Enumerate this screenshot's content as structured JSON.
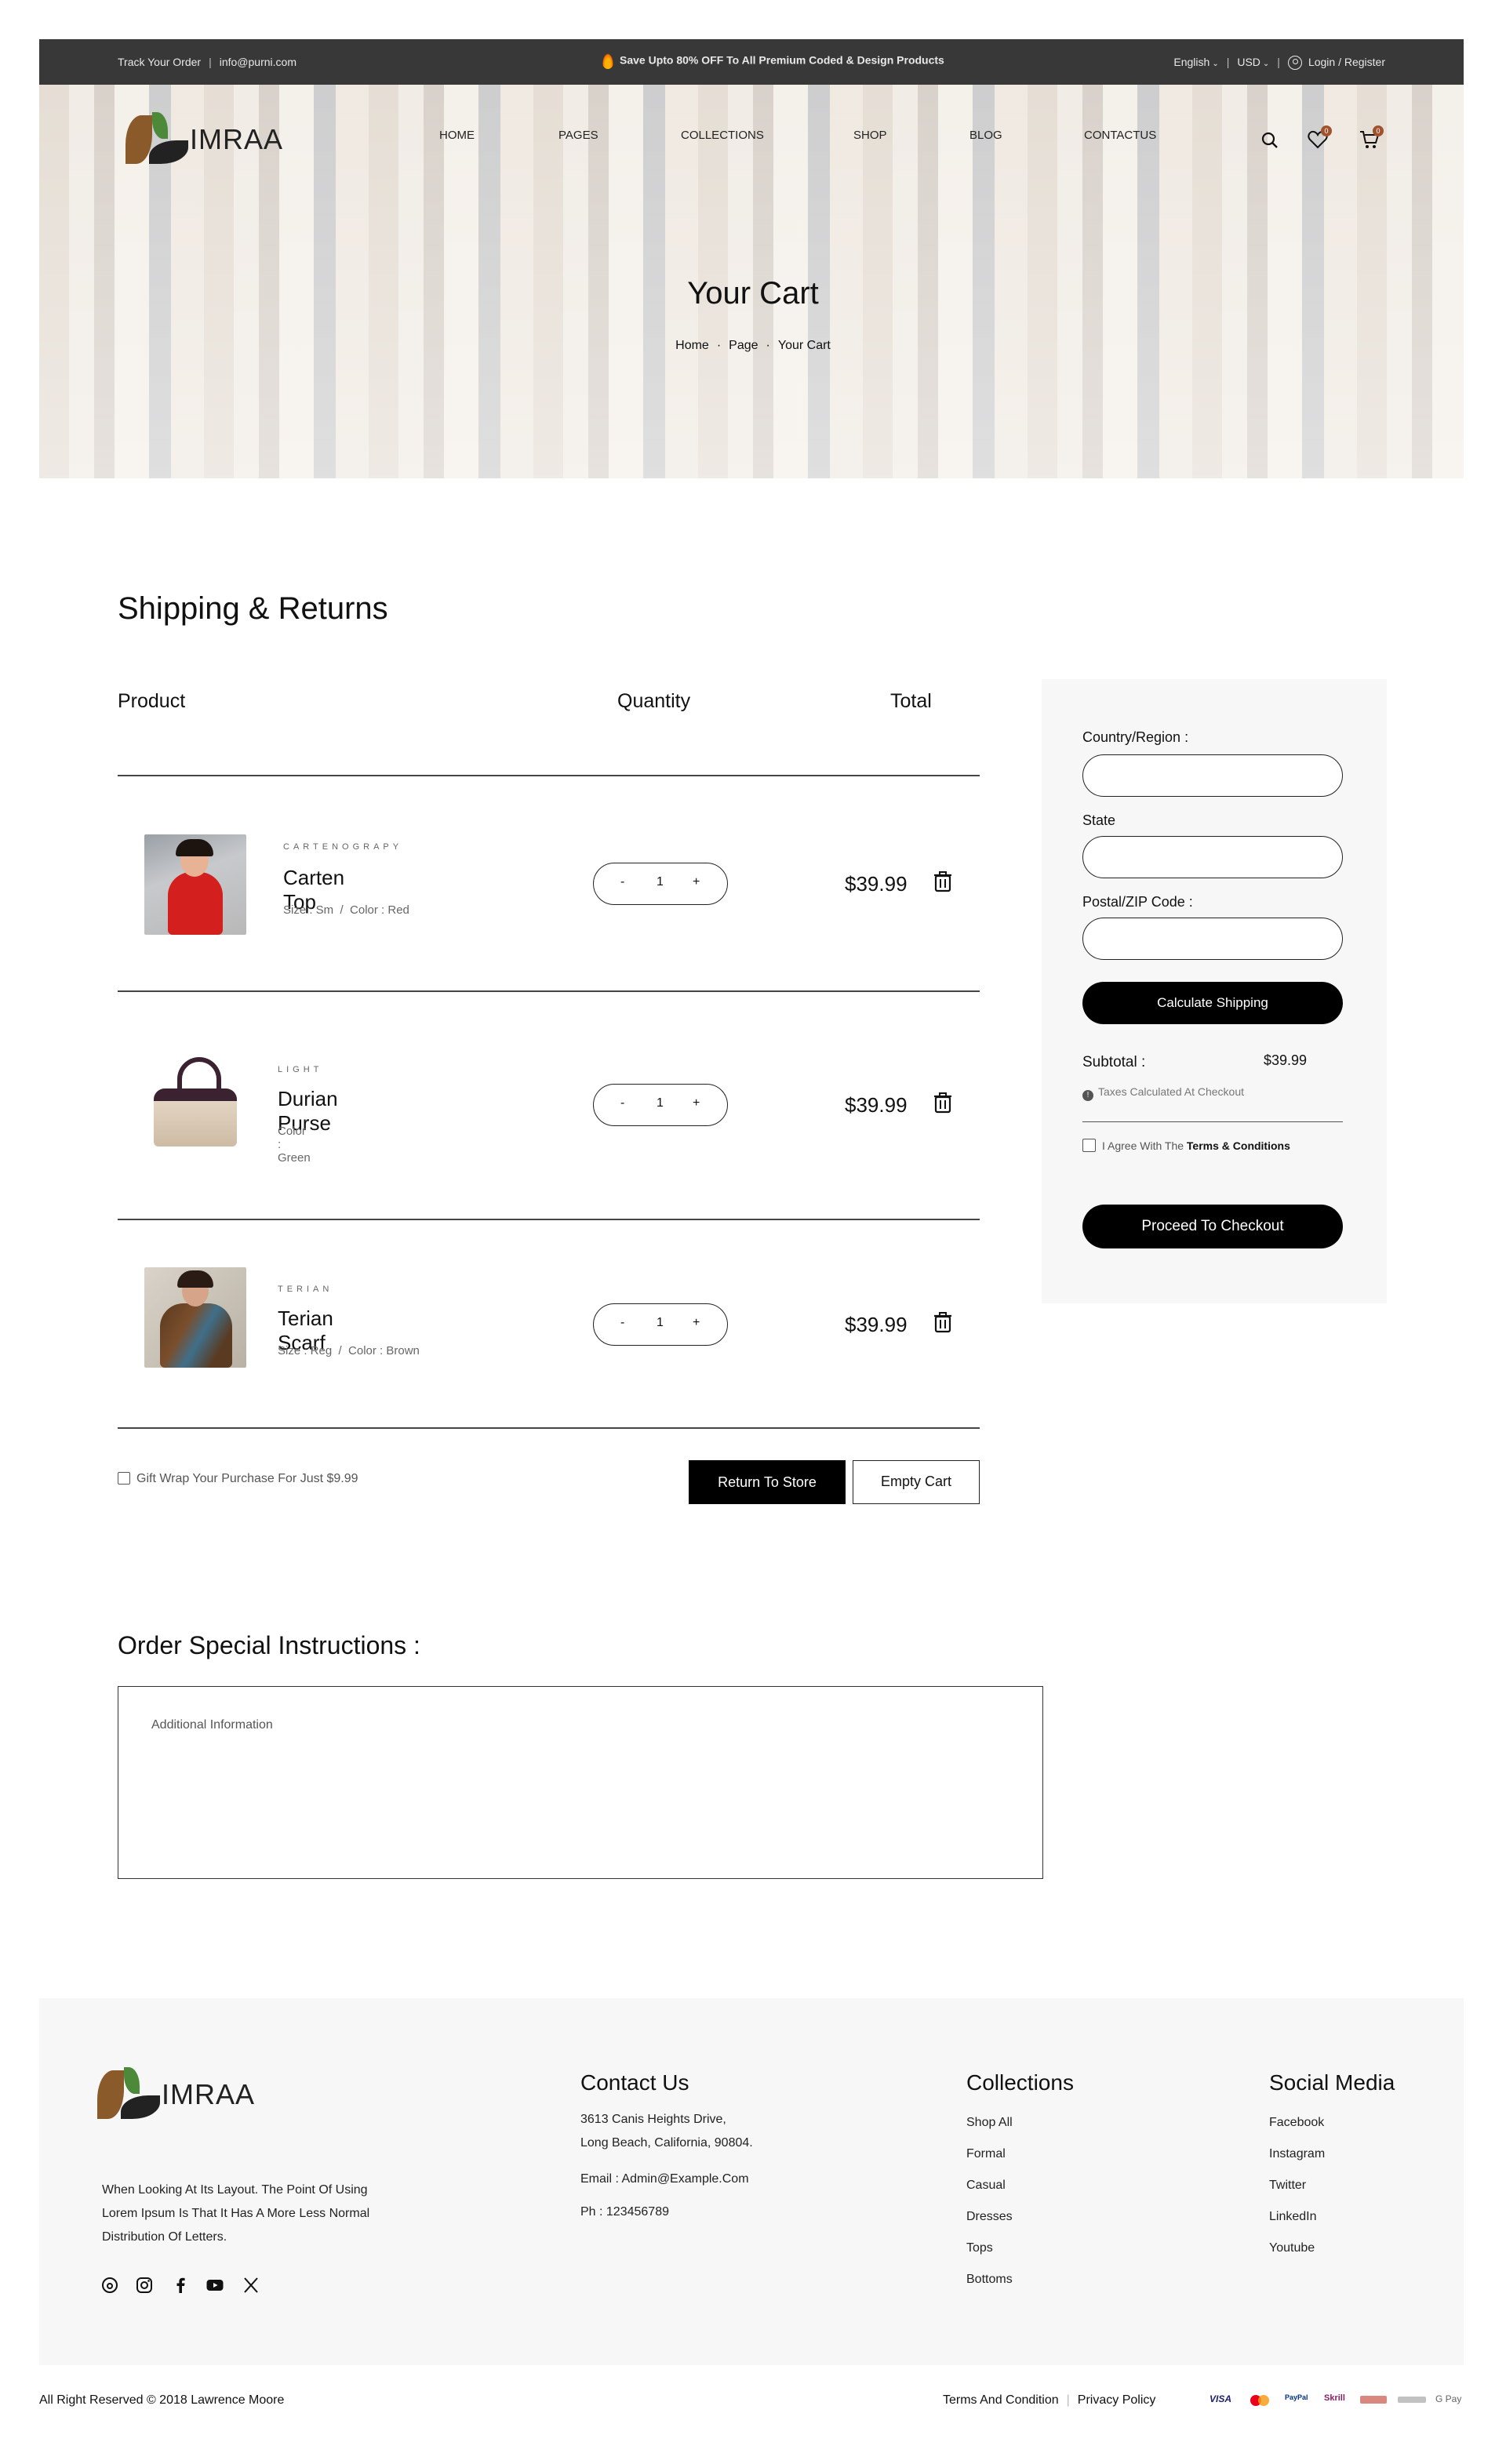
{
  "topbar": {
    "track": "Track Your Order",
    "email": "info@purni.com",
    "promo": "Save Upto 80% OFF To All Premium Coded & Design Products",
    "language": "English",
    "currency": "USD",
    "login": "Login / Register"
  },
  "brand": {
    "name": "IMRAA"
  },
  "nav": {
    "home": "HOME",
    "pages": "PAGES",
    "collections": "COLLECTIONS",
    "shop": "SHOP",
    "blog": "BLOG",
    "contact": "CONTACTUS"
  },
  "header_icons": {
    "search": "search-icon",
    "wishlist": "heart-icon",
    "cart": "cart-icon",
    "wishlist_count": "0",
    "cart_count": "0"
  },
  "hero": {
    "title": "Your Cart",
    "crumb_home": "Home",
    "crumb_page": "Page",
    "crumb_current": "Your Cart"
  },
  "cart": {
    "section_title": "Shipping & Returns",
    "col_product": "Product",
    "col_quantity": "Quantity",
    "col_total": "Total",
    "items": [
      {
        "category": "CARTENOGRAPY",
        "name": "Carten Top",
        "meta": "Size : Sm  /  Color : Red",
        "qty": "1",
        "price": "$39.99"
      },
      {
        "category": "LIGHT",
        "name": "Durian Purse",
        "meta": "Color : Green",
        "qty": "1",
        "price": "$39.99"
      },
      {
        "category": "TERIAN",
        "name": "Terian Scarf",
        "meta": "Size : Reg  /  Color : Brown",
        "qty": "1",
        "price": "$39.99"
      }
    ],
    "gift_wrap": "Gift Wrap Your Purchase For Just $9.99",
    "return_btn": "Return To Store",
    "empty_btn": "Empty Cart"
  },
  "summary": {
    "country_label": "Country/Region :",
    "state_label": "State",
    "zip_label": "Postal/ZIP Code :",
    "calc_btn": "Calculate Shipping",
    "subtotal_label": "Subtotal :",
    "subtotal_value": "$39.99",
    "tax_note": "Taxes Calculated At Checkout",
    "agree_prefix": "I Agree With The ",
    "agree_link": "Terms & Conditions",
    "checkout_btn": "Proceed To Checkout"
  },
  "instructions": {
    "title": "Order Special Instructions :",
    "placeholder": "Additional Information"
  },
  "footer": {
    "about": [
      "When Looking At Its Layout. The Point Of Using",
      "Lorem Ipsum Is That It Has A More Less Normal",
      "Distribution Of Letters."
    ],
    "contact_title": "Contact Us",
    "address1": "3613 Canis Heights Drive,",
    "address2": "Long Beach, California, 90804.",
    "email": "Email : Admin@Example.Com",
    "phone": "Ph : 123456789",
    "collections_title": "Collections",
    "collections": [
      "Shop All",
      "Formal",
      "Casual",
      "Dresses",
      "Tops",
      "Bottoms"
    ],
    "social_title": "Social Media",
    "social": [
      "Facebook",
      "Instagram",
      "Twitter",
      "LinkedIn",
      "Youtube"
    ],
    "copyright": "All Right Reserved © 2018 Lawrence Moore",
    "terms": "Terms And Condition",
    "privacy": "Privacy Policy",
    "payments": [
      "VISA",
      "PayPal",
      "Skrill",
      "G Pay"
    ]
  }
}
